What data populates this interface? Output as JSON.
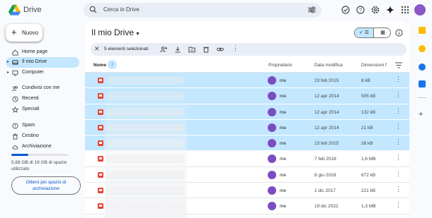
{
  "app": {
    "brand": "Drive"
  },
  "search": {
    "placeholder": "Cerca in Drive"
  },
  "header_icons": [
    "offline-check-icon",
    "help-icon",
    "settings-icon",
    "gemini-icon",
    "apps-grid-icon"
  ],
  "sidebar": {
    "new_label": "Nuovo",
    "items": [
      {
        "label": "Home page",
        "icon": "home-icon"
      },
      {
        "label": "Il mio Drive",
        "icon": "my-drive-icon",
        "active": true
      },
      {
        "label": "Computer",
        "icon": "computer-icon"
      },
      {
        "label": "Condivisi con me",
        "icon": "shared-icon"
      },
      {
        "label": "Recenti",
        "icon": "clock-icon"
      },
      {
        "label": "Speciali",
        "icon": "star-icon"
      },
      {
        "label": "Spam",
        "icon": "spam-icon"
      },
      {
        "label": "Cestino",
        "icon": "trash-icon"
      },
      {
        "label": "Archiviazione",
        "icon": "cloud-icon"
      }
    ],
    "storage_used_fraction": 0.3,
    "storage_text": "5,68 GB di 19 GB di spazio utilizzato",
    "more_storage_label": "Ottieni più spazio di archiviazione"
  },
  "main": {
    "title": "Il mio Drive",
    "selection_count": "5 elementi selezionati",
    "columns": {
      "name": "Nome",
      "owner": "Proprietario",
      "modified": "Data modifica",
      "size": "Dimensioni f"
    },
    "rows": [
      {
        "owner": "me",
        "date": "23 feb 2015",
        "size": "6 kB",
        "selected": true
      },
      {
        "owner": "me",
        "date": "12 apr 2014",
        "size": "505 kB",
        "selected": true
      },
      {
        "owner": "me",
        "date": "12 apr 2014",
        "size": "132 kB",
        "selected": true
      },
      {
        "owner": "me",
        "date": "12 apr 2014",
        "size": "21 kB",
        "selected": true
      },
      {
        "owner": "me",
        "date": "23 feb 2015",
        "size": "28 kB",
        "selected": true
      },
      {
        "owner": "me",
        "date": "7 feb 2018",
        "size": "1,6 MB",
        "selected": false
      },
      {
        "owner": "me",
        "date": "8 giu 2018",
        "size": "672 kB",
        "selected": false
      },
      {
        "owner": "me",
        "date": "1 dic 2017",
        "size": "221 kB",
        "selected": false
      },
      {
        "owner": "me",
        "date": "19 dic 2022",
        "size": "1,3 MB",
        "selected": false
      }
    ]
  },
  "colors": {
    "accent": "#0b57d0",
    "selected": "#c2e7ff",
    "image_icon": "#ea4335",
    "avatar": "#7b4cc2"
  }
}
